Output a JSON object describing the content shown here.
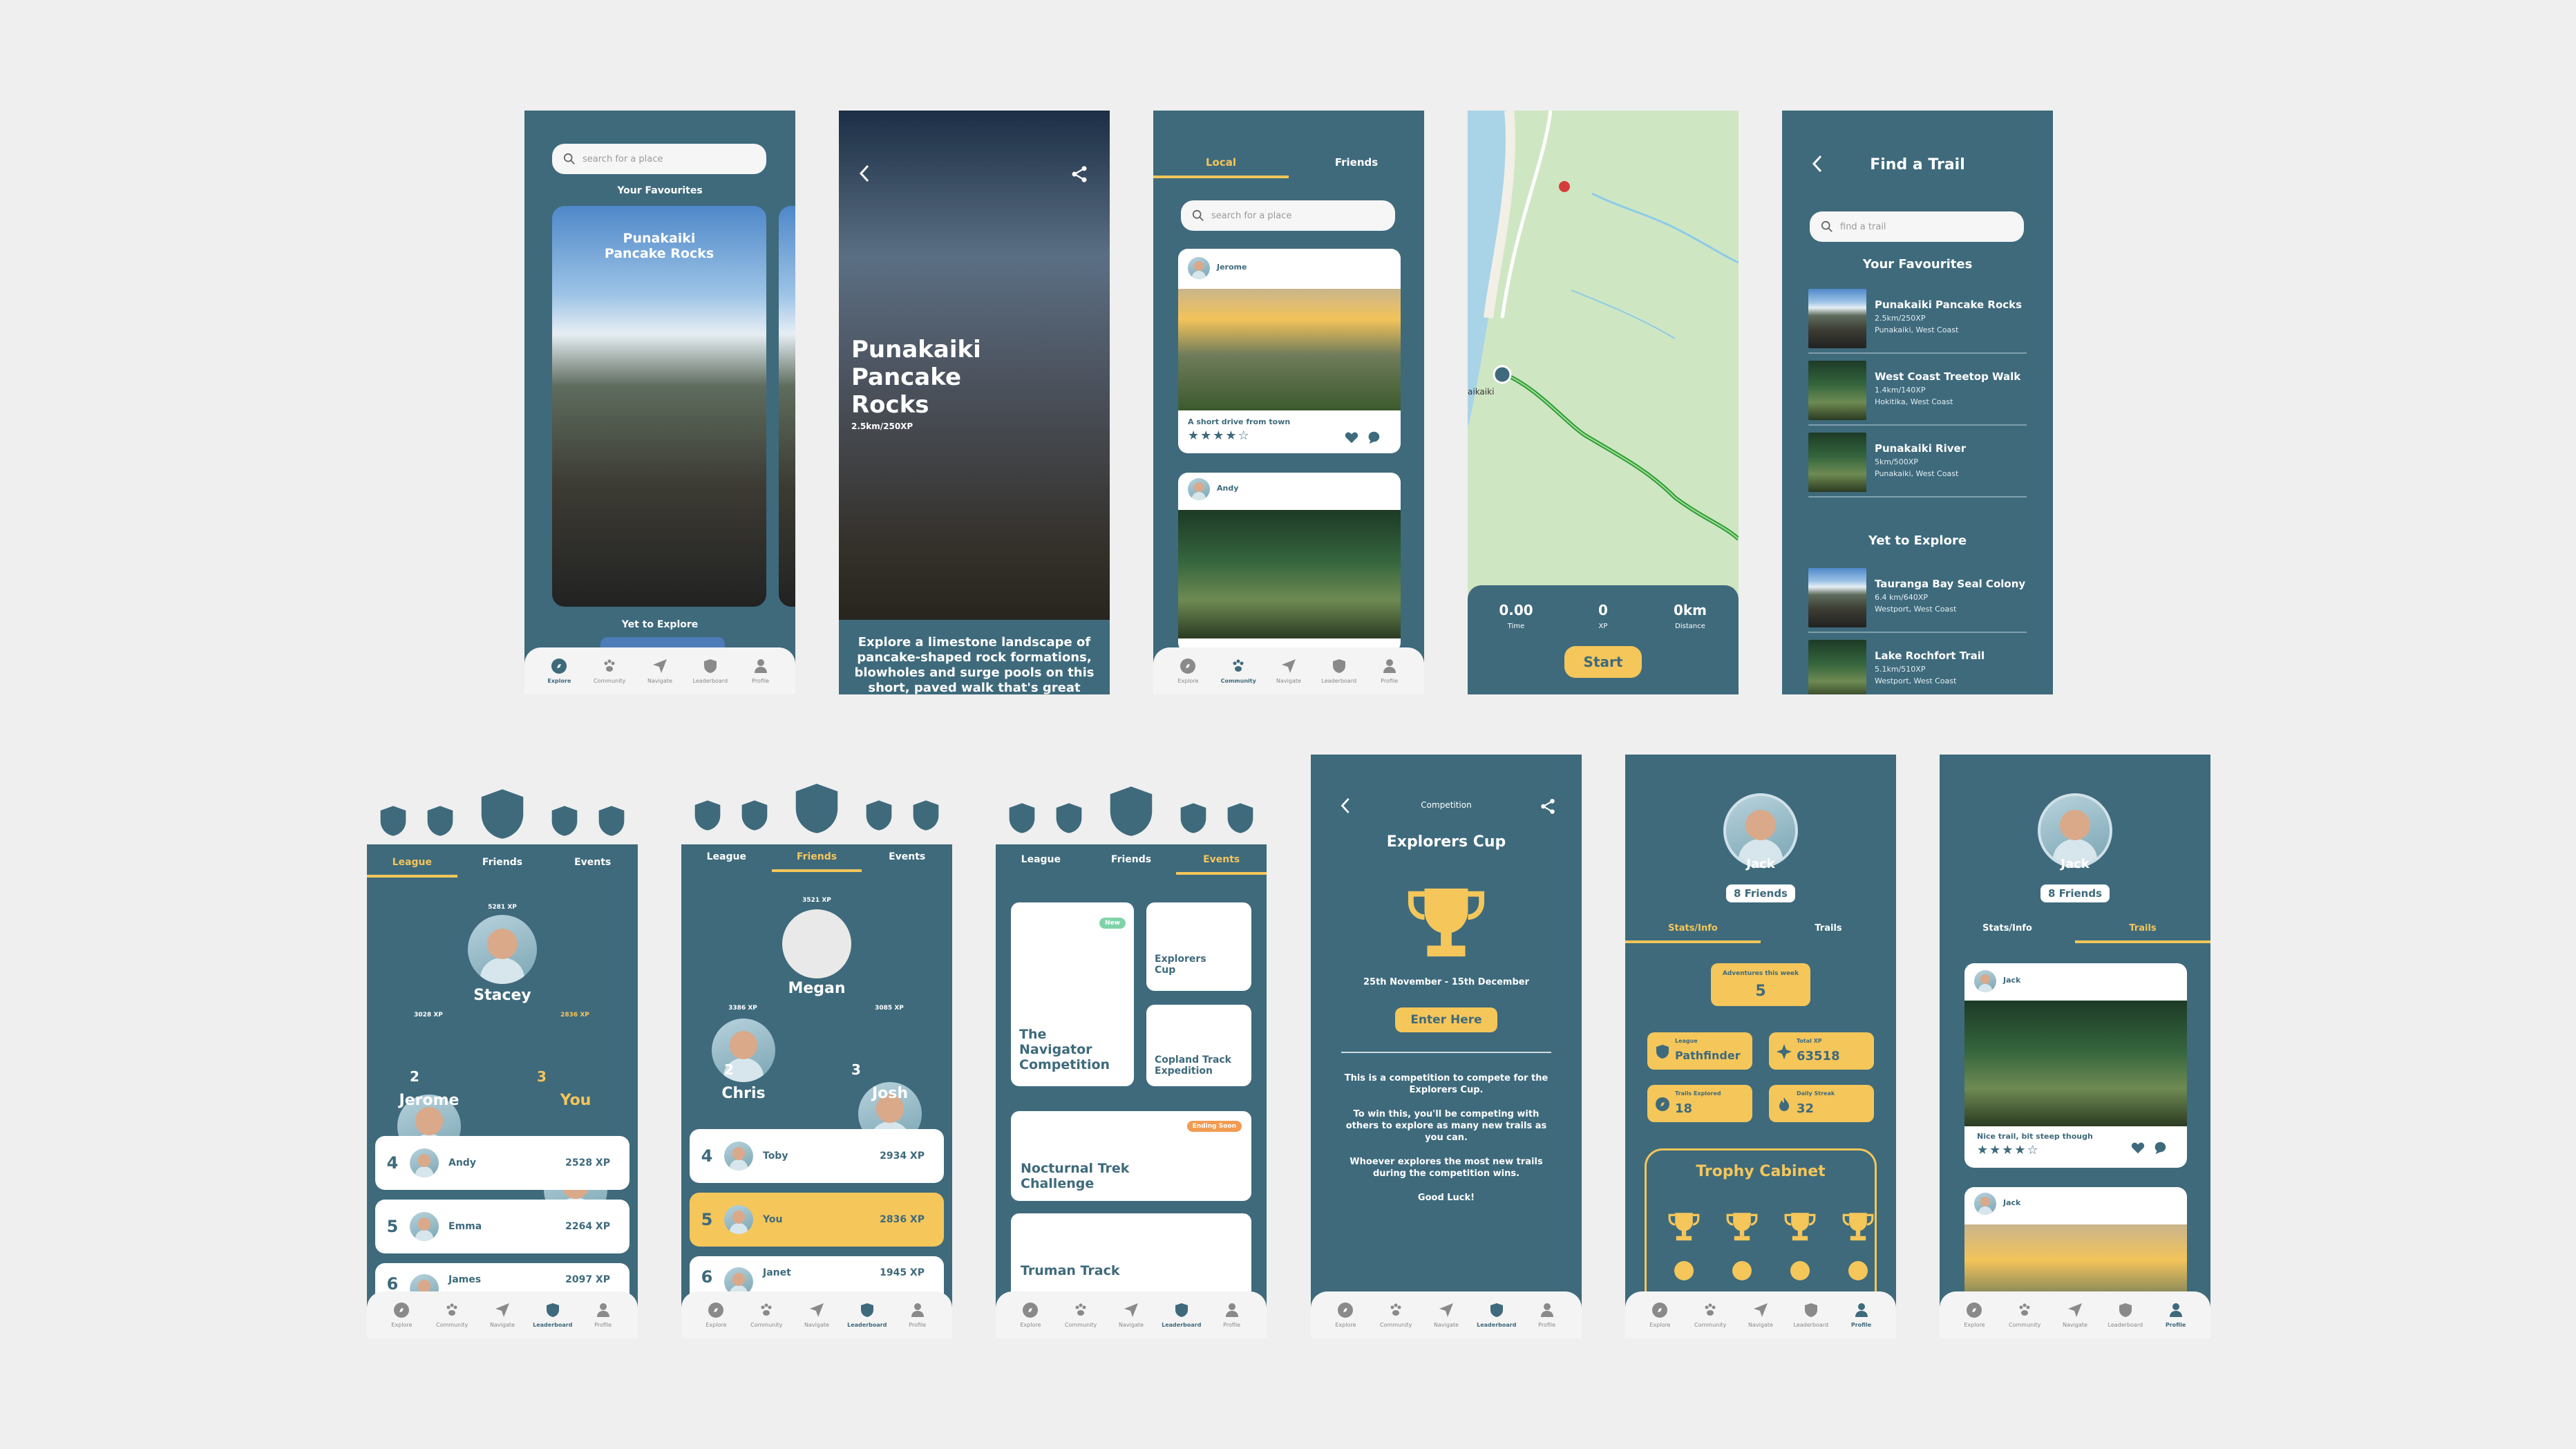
{
  "nav": {
    "explore": "Explore",
    "community": "Community",
    "navigate": "Navigate",
    "leaderboard": "Leaderboard",
    "profile": "Profile"
  },
  "s1": {
    "search_placeholder": "search for a place",
    "favourites": "Your Favourites",
    "card_title": "Punakaiki\nPancake Rocks",
    "yet": "Yet to Explore"
  },
  "s2": {
    "title": "Punakaiki\nPancake\nRocks",
    "meta": "2.5km/250XP",
    "desc": "Explore a limestone landscape of pancake-shaped rock formations, blowholes and surge pools on this short, paved walk that's great"
  },
  "s3": {
    "tab_local": "Local",
    "tab_friends": "Friends",
    "search_placeholder": "search for a place",
    "post1_user": "Jerome",
    "post1_caption": "A short drive from town",
    "post2_user": "Andy"
  },
  "s4": {
    "town_label": "aikaiki",
    "time_value": "0.00",
    "time_label": "Time",
    "xp_value": "0",
    "xp_label": "XP",
    "dist_value": "0km",
    "dist_label": "Distance",
    "start": "Start"
  },
  "s5": {
    "title": "Find a Trail",
    "search_placeholder": "find a trail",
    "favourites": "Your Favourites",
    "yet": "Yet to Explore",
    "fav": [
      {
        "name": "Punakaiki Pancake Rocks",
        "meta": "2.5km/250XP",
        "loc": "Punakaiki, West Coast"
      },
      {
        "name": "West Coast Treetop Walk",
        "meta": "1.4km/140XP",
        "loc": "Hokitika, West Coast"
      },
      {
        "name": "Punakaiki River",
        "meta": "5km/500XP",
        "loc": "Punakaiki, West Coast"
      }
    ],
    "todo": [
      {
        "name": "Tauranga Bay Seal Colony",
        "meta": "6.4 km/640XP",
        "loc": "Westport, West Coast"
      },
      {
        "name": "Lake Rochfort Trail",
        "meta": "5.1km/510XP",
        "loc": "Westport, West Coast"
      }
    ]
  },
  "lb": {
    "tab_league": "League",
    "tab_friends": "Friends",
    "tab_events": "Events"
  },
  "d1": {
    "first": {
      "name": "Stacey",
      "xp": "5281 XP"
    },
    "second": {
      "name": "Jerome",
      "xp": "3028 XP",
      "rank": "2"
    },
    "third": {
      "name": "You",
      "xp": "2836 XP",
      "rank": "3"
    },
    "rows": [
      {
        "rank": "4",
        "name": "Andy",
        "xp": "2528 XP"
      },
      {
        "rank": "5",
        "name": "Emma",
        "xp": "2264 XP"
      },
      {
        "rank": "6",
        "name": "James",
        "xp": "2097 XP"
      }
    ]
  },
  "d2": {
    "first": {
      "name": "Megan",
      "xp": "3521 XP"
    },
    "second": {
      "name": "Chris",
      "xp": "3386 XP",
      "rank": "2"
    },
    "third": {
      "name": "Josh",
      "xp": "3085 XP",
      "rank": "3"
    },
    "rows": [
      {
        "rank": "4",
        "name": "Toby",
        "xp": "2934 XP"
      },
      {
        "rank": "5",
        "name": "You",
        "xp": "2836 XP"
      },
      {
        "rank": "6",
        "name": "Janet",
        "xp": "1945 XP"
      }
    ]
  },
  "d3": {
    "new_badge": "New",
    "ending_badge": "Ending Soon",
    "ev1": "The\nNavigator\nCompetition",
    "ev2": "Explorers\nCup",
    "ev3": "Copland Track\nExpedition",
    "ev4": "Nocturnal Trek\nChallenge",
    "ev5": "Truman Track"
  },
  "d4": {
    "header": "Competition",
    "title": "Explorers Cup",
    "dates": "25th November - 15th December",
    "enter": "Enter Here",
    "p1": "This is a competition to compete for the Explorers Cup.",
    "p2": "To win this, you'll be competing with others to explore as many new trails as you can.",
    "p3": "Whoever explores the most new trails during the competition wins.",
    "p4": "Good Luck!"
  },
  "d5": {
    "name": "Jack",
    "friends": "8 Friends",
    "tab_stats": "Stats/Info",
    "tab_trails": "Trails",
    "adv_label": "Adventures this week",
    "adv_value": "5",
    "league_label": "League",
    "league_value": "Pathfinder",
    "totalxp_label": "Total XP",
    "totalxp_value": "63518",
    "explored_label": "Trails Explored",
    "explored_value": "18",
    "streak_label": "Daily Streak",
    "streak_value": "32",
    "trophy": "Trophy Cabinet"
  },
  "d6": {
    "name": "Jack",
    "friends": "8 Friends",
    "tab_stats": "Stats/Info",
    "tab_trails": "Trails",
    "post1_user": "Jack",
    "post1_caption": "Nice trail, bit steep though",
    "post2_user": "Jack"
  },
  "colors": {
    "teal": "#3e6a7c",
    "yellow": "#f5c65a",
    "bg": "#efefef"
  }
}
